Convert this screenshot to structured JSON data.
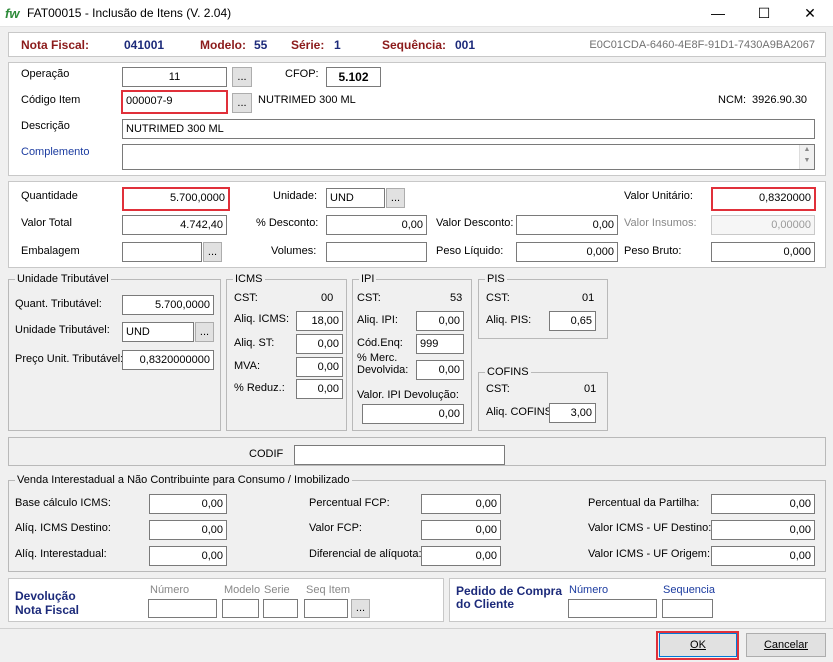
{
  "window": {
    "logo": "fw",
    "title": "FAT00015 - Inclusão de Itens (V. 2.04)",
    "min_icon": "—",
    "max_icon": "☐",
    "close_icon": "✕"
  },
  "header": {
    "nf_label": "Nota Fiscal:",
    "nf_value": "041001",
    "modelo_label": "Modelo:",
    "modelo_value": "55",
    "serie_label": "Série:",
    "serie_value": "1",
    "seq_label": "Sequência:",
    "seq_value": "001",
    "key": "E0C01CDA-6460-4E8F-91D1-7430A9BA2067"
  },
  "item": {
    "operacao_label": "Operação",
    "operacao_value": "11",
    "cfop_label": "CFOP:",
    "cfop_value": "5.102",
    "codigo_label": "Código Item",
    "codigo_value": "000007-9",
    "codigo_desc": "NUTRIMED 300 ML",
    "ncm_label": "NCM:",
    "ncm_value": "3926.90.30",
    "descricao_label": "Descrição",
    "descricao_value": "NUTRIMED 300 ML",
    "complemento_label": "Complemento",
    "complemento_value": ""
  },
  "values": {
    "quantidade_label": "Quantidade",
    "quantidade_value": "5.700,0000",
    "unidade_label": "Unidade:",
    "unidade_value": "UND",
    "valor_unitario_label": "Valor Unitário:",
    "valor_unitario_value": "0,8320000",
    "valor_total_label": "Valor Total",
    "valor_total_value": "4.742,40",
    "desconto_pct_label": "% Desconto:",
    "desconto_pct_value": "0,00",
    "valor_desconto_label": "Valor Desconto:",
    "valor_desconto_value": "0,00",
    "valor_insumos_label": "Valor Insumos:",
    "valor_insumos_value": "0,00000",
    "embalagem_label": "Embalagem",
    "embalagem_value": "",
    "volumes_label": "Volumes:",
    "volumes_value": "",
    "peso_liquido_label": "Peso Líquido:",
    "peso_liquido_value": "0,000",
    "peso_bruto_label": "Peso Bruto:",
    "peso_bruto_value": "0,000"
  },
  "tributavel": {
    "title": "Unidade Tributável",
    "quant_label": "Quant. Tributável:",
    "quant_value": "5.700,0000",
    "unid_label": "Unidade Tributável:",
    "unid_value": "UND",
    "preco_label": "Preço Unit. Tributável:",
    "preco_value": "0,8320000000"
  },
  "icms": {
    "title": "ICMS",
    "cst_label": "CST:",
    "cst_value": "00",
    "aliq_label": "Aliq. ICMS:",
    "aliq_value": "18,00",
    "aliq_st_label": "Aliq. ST:",
    "aliq_st_value": "0,00",
    "mva_label": "MVA:",
    "mva_value": "0,00",
    "reduz_label": "% Reduz.:",
    "reduz_value": "0,00"
  },
  "ipi": {
    "title": "IPI",
    "cst_label": "CST:",
    "cst_value": "53",
    "aliq_label": "Aliq. IPI:",
    "aliq_value": "0,00",
    "cod_label": "Cód.Enq:",
    "cod_value": "999",
    "merc_label1": "% Merc.",
    "merc_label2": "Devolvida:",
    "merc_value": "0,00",
    "devol_label": "Valor. IPI Devolução:",
    "devol_value": "0,00"
  },
  "pis": {
    "title": "PIS",
    "cst_label": "CST:",
    "cst_value": "01",
    "aliq_label": "Aliq. PIS:",
    "aliq_value": "0,65"
  },
  "cofins": {
    "title": "COFINS",
    "cst_label": "CST:",
    "cst_value": "01",
    "aliq_label": "Aliq. COFINS:",
    "aliq_value": "3,00"
  },
  "codif": {
    "label": "CODIF",
    "value": ""
  },
  "venda": {
    "title": "Venda Interestadual a Não Contribuinte para Consumo / Imobilizado",
    "base_label": "Base cálculo ICMS:",
    "base_value": "0,00",
    "aliq_dest_label": "Alíq. ICMS Destino:",
    "aliq_dest_value": "0,00",
    "aliq_inter_label": "Alíq. Interestadual:",
    "aliq_inter_value": "0,00",
    "pct_fcp_label": "Percentual FCP:",
    "pct_fcp_value": "0,00",
    "valor_fcp_label": "Valor FCP:",
    "valor_fcp_value": "0,00",
    "dif_label": "Diferencial de alíquota:",
    "dif_value": "0,00",
    "partilha_label": "Percentual da Partilha:",
    "partilha_value": "0,00",
    "uf_dest_label": "Valor ICMS - UF Destino:",
    "uf_dest_value": "0,00",
    "uf_orig_label": "Valor ICMS - UF Origem:",
    "uf_orig_value": "0,00"
  },
  "devolucao": {
    "title1": "Devolução",
    "title2": "Nota Fiscal",
    "numero_label": "Número",
    "modelo_label": "Modelo",
    "serie_label": "Serie",
    "seq_label": "Seq Item"
  },
  "pedido": {
    "title1": "Pedido de Compra",
    "title2": "do Cliente",
    "numero_label": "Número",
    "seq_label": "Sequencia"
  },
  "buttons": {
    "ellipsis": "...",
    "ok": "OK",
    "cancel": "Cancelar"
  }
}
